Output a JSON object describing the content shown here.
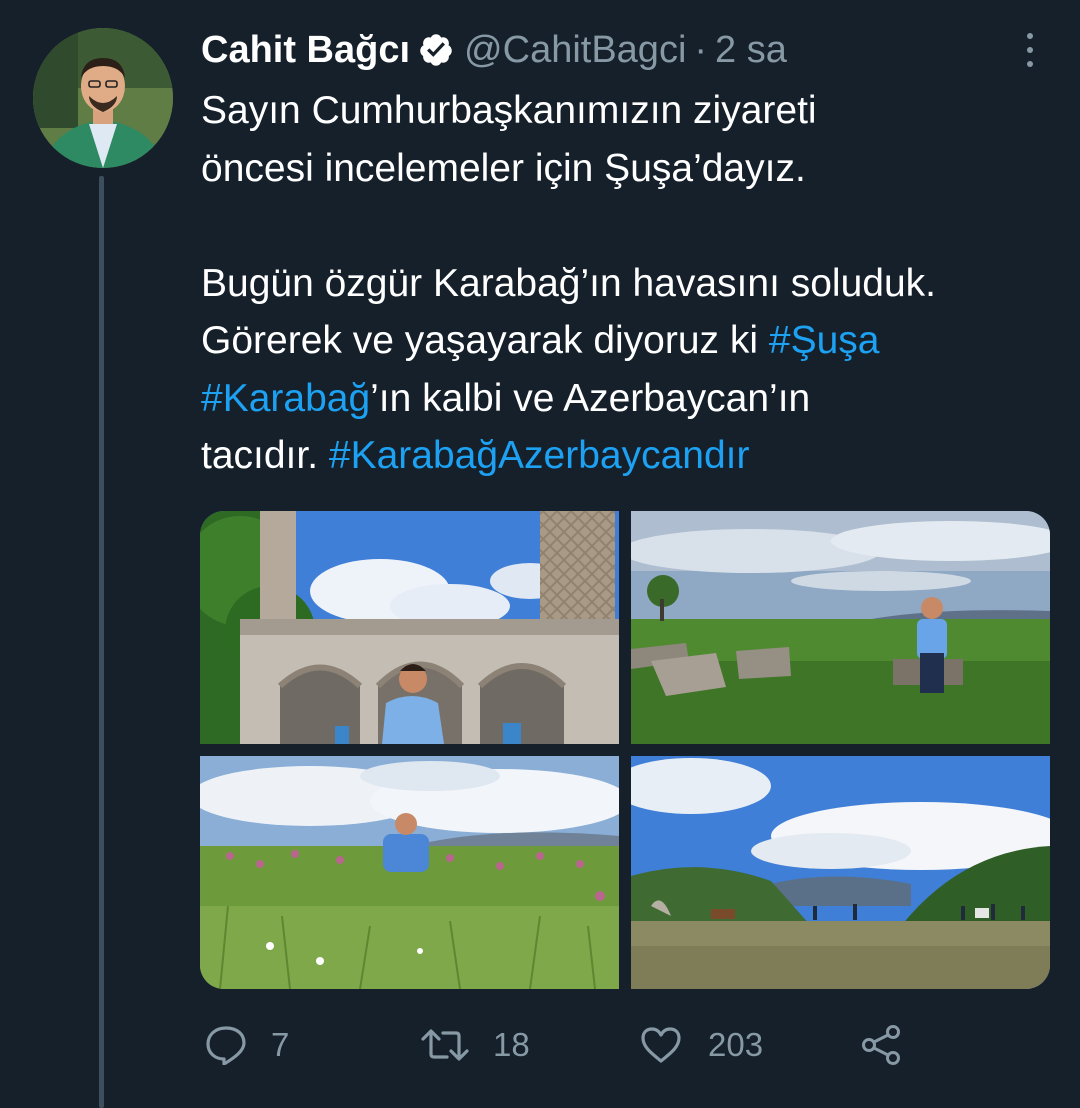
{
  "tweet": {
    "author_name": "Cahit Bağcı",
    "handle": "@CahitBagci",
    "separator": "·",
    "time": "2 sa",
    "verified": true,
    "text_lines": [
      [
        {
          "t": "Sayın Cumhurbaşkanımızın ziyareti"
        }
      ],
      [
        {
          "t": "öncesi incelemeler için Şuşa’dayız."
        }
      ],
      [],
      [
        {
          "t": "Bugün özgür Karabağ’ın havasını soluduk."
        }
      ],
      [
        {
          "t": "Görerek ve yaşayarak diyoruz ki "
        },
        {
          "t": "#Şuşa",
          "hashtag": true
        }
      ],
      [
        {
          "t": "#Karabağ",
          "hashtag": true
        },
        {
          "t": "’ın kalbi ve Azerbaycan’ın"
        }
      ],
      [
        {
          "t": "tacıdır. "
        },
        {
          "t": "#KarabağAzerbaycandır",
          "hashtag": true
        }
      ]
    ],
    "photos_count": 4
  },
  "actions": {
    "reply_count": "7",
    "retweet_count": "18",
    "like_count": "203"
  },
  "colors": {
    "background": "#15202b",
    "text": "#ffffff",
    "muted": "#8899a6",
    "accent": "#1da1f2",
    "thread_line": "#3d4e5c"
  },
  "icons": [
    "verified-badge-icon",
    "more-options-icon",
    "reply-icon",
    "retweet-icon",
    "like-icon",
    "share-icon"
  ]
}
